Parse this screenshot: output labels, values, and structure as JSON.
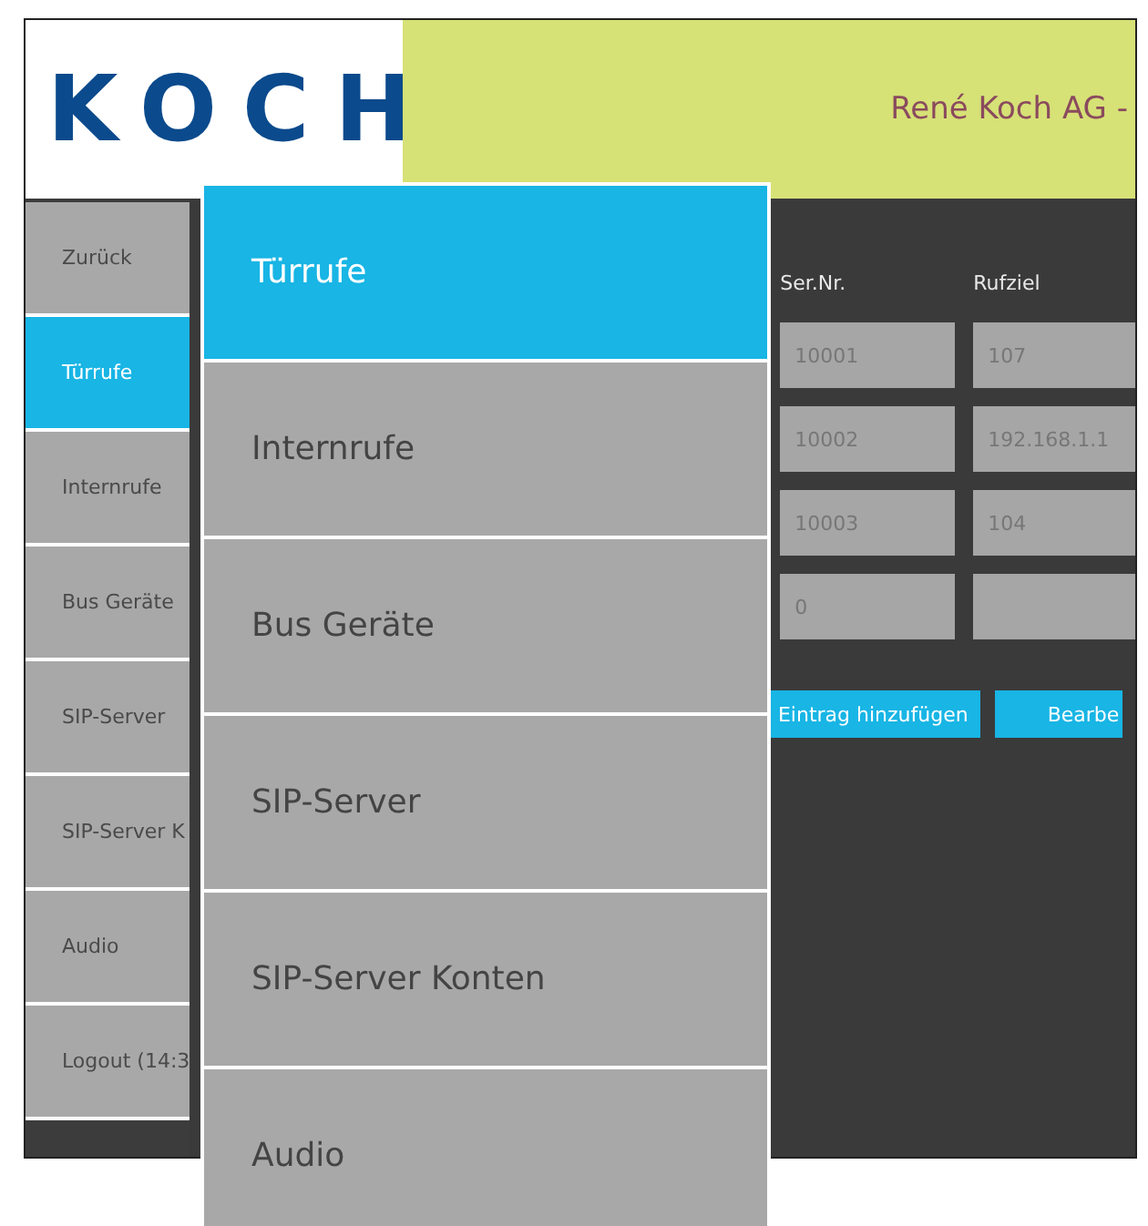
{
  "header": {
    "logo": "KOCH",
    "title": "René Koch AG -"
  },
  "sidebar": {
    "items": [
      {
        "label": "Zurück",
        "selected": false
      },
      {
        "label": "Türrufe",
        "selected": true
      },
      {
        "label": "Internrufe",
        "selected": false
      },
      {
        "label": "Bus Geräte",
        "selected": false
      },
      {
        "label": "SIP-Server",
        "selected": false
      },
      {
        "label": "SIP-Server K",
        "selected": false
      },
      {
        "label": "Audio",
        "selected": false
      },
      {
        "label": "Logout (14:3",
        "selected": false
      }
    ]
  },
  "table": {
    "columns": [
      "Ser.Nr.",
      "Rufziel"
    ],
    "rows": [
      [
        "10001",
        "107"
      ],
      [
        "10002",
        "192.168.1.1"
      ],
      [
        "10003",
        "104"
      ],
      [
        "0",
        ""
      ]
    ]
  },
  "buttons": [
    "Eintrag hinzufügen",
    "Bearbe"
  ],
  "menu_overlay": {
    "items": [
      {
        "label": "Türrufe",
        "selected": true
      },
      {
        "label": "Internrufe",
        "selected": false
      },
      {
        "label": "Bus Geräte",
        "selected": false
      },
      {
        "label": "SIP-Server",
        "selected": false
      },
      {
        "label": "SIP-Server Konten",
        "selected": false
      },
      {
        "label": "Audio",
        "selected": false
      }
    ]
  }
}
